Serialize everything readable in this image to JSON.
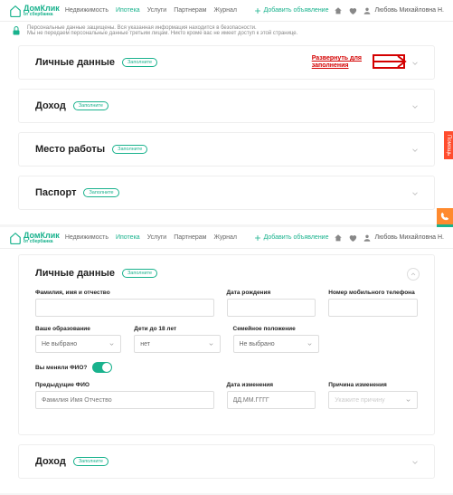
{
  "brand": {
    "name": "ДомКлик",
    "sub": "от сбербанка"
  },
  "nav": {
    "items": [
      "Недвижимость",
      "Ипотека",
      "Услуги",
      "Партнерам",
      "Журнал"
    ],
    "activeIndex": 1
  },
  "header": {
    "add": "Добавить объявление",
    "user": "Любовь Михайловна Н."
  },
  "notice": {
    "line1": "Персональные данные защищены. Вся указанная информация находится в безопасности.",
    "line2": "Мы не передаем персональные данные третьим лицам. Никто кроме вас не имеет доступ к этой странице."
  },
  "badge": "Заполните",
  "sections": {
    "personal": "Личные данные",
    "income": "Доход",
    "work": "Место работы",
    "passport": "Паспорт"
  },
  "expandMsg": {
    "l1": "Развернуть для",
    "l2": "заполнения"
  },
  "form": {
    "fio": "Фамилия, имя и отчество",
    "dob": "Дата рождения",
    "phone": "Номер мобильного телефона",
    "edu": "Ваше образование",
    "eduVal": "Не выбрано",
    "kids": "Дети до 18 лет",
    "kidsVal": "нет",
    "marital": "Семейное положение",
    "maritalVal": "Не выбрано",
    "changedName": "Вы меняли ФИО?",
    "prevFio": "Предыдущие ФИО",
    "prevFioPh": "Фамилия Имя Отчество",
    "changeDate": "Дата изменения",
    "changeDatePh": "ДД.ММ.ГГГГ",
    "reason": "Причина изменения",
    "reasonPh": "Укажите причину"
  },
  "sideTabs": {
    "help": "Помощь"
  }
}
